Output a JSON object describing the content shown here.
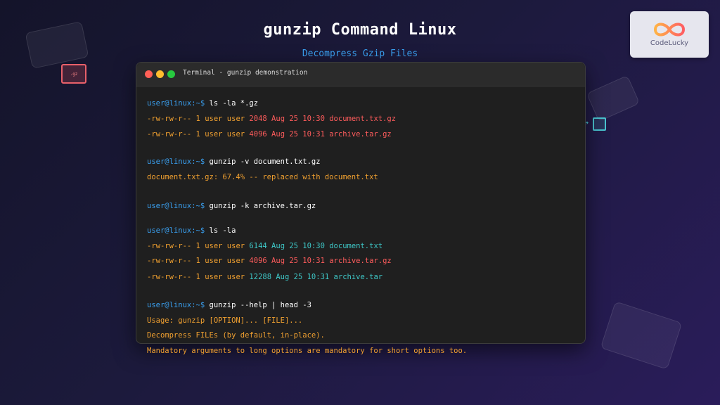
{
  "page": {
    "title": "gunzip Command Linux",
    "subtitle": "Decompress Gzip Files",
    "badge_icon_text": ".gz"
  },
  "logo": {
    "text": "CodeLucky"
  },
  "terminal": {
    "title": "Terminal - gunzip demonstration",
    "prompt": "user@linux:~$",
    "commands": [
      "ls -la *.gz",
      "gunzip -v document.txt.gz",
      "gunzip -k archive.tar.gz",
      "ls -la",
      "gunzip --help | head -3"
    ],
    "listing1": [
      {
        "perm": "-rw-rw-r--",
        "meta": "1 user user",
        "size": "2048",
        "date": "Aug 25 10:30",
        "name": "document.txt.gz"
      },
      {
        "perm": "-rw-rw-r--",
        "meta": "1 user user",
        "size": "4096",
        "date": "Aug 25 10:31",
        "name": "archive.tar.gz"
      }
    ],
    "verbose_output": "document.txt.gz: 67.4% -- replaced with document.txt",
    "listing2": [
      {
        "perm": "-rw-rw-r--",
        "meta": "1 user user",
        "size": "6144",
        "date": "Aug 25 10:30",
        "name": "document.txt"
      },
      {
        "perm": "-rw-rw-r--",
        "meta": "1 user user",
        "size": "4096",
        "date": "Aug 25 10:31",
        "name": "archive.tar.gz"
      },
      {
        "perm": "-rw-rw-r--",
        "meta": "1 user user",
        "size": "12288",
        "date": "Aug 25 10:31",
        "name": "archive.tar"
      }
    ],
    "help_output": [
      "Usage: gunzip [OPTION]... [FILE]...",
      "Decompress FILEs (by default, in-place).",
      "Mandatory arguments to long options are mandatory for short options too."
    ]
  },
  "colors": {
    "prompt": "#3aa0f0",
    "command": "#ffffff",
    "output": "#f0a030",
    "gz_file": "#ff5c5c",
    "plain_file": "#3ec7c7"
  }
}
